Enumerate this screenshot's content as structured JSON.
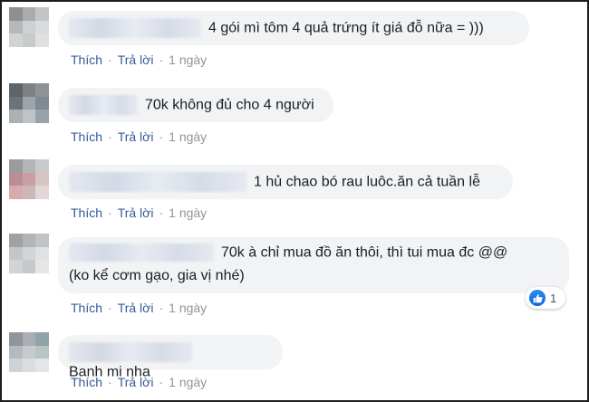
{
  "comments": [
    {
      "text": "4 gói mì tôm 4 quả trứng ít giá đỗ nữa = )))",
      "actions": {
        "like": "Thích",
        "reply": "Trả lời",
        "time": "1 ngày"
      }
    },
    {
      "text": "70k không đủ cho 4 người",
      "actions": {
        "like": "Thích",
        "reply": "Trả lời",
        "time": "1 ngày"
      }
    },
    {
      "text": "1 hủ chao bó rau luôc.ăn cả tuần lễ",
      "actions": {
        "like": "Thích",
        "reply": "Trả lời",
        "time": "1 ngày"
      }
    },
    {
      "text_line1": "70k à chỉ mua đồ ăn thôi, thì tui mua đc @@",
      "text_line2": "(ko kể cơm gạo, gia vị nhé)",
      "actions": {
        "like": "Thích",
        "reply": "Trả lời",
        "time": "1 ngày"
      },
      "reaction_count": "1"
    },
    {
      "text": "Banh mi nha",
      "actions": {
        "like": "Thích",
        "reply": "Trả lời",
        "time": "1 ngày"
      }
    }
  ],
  "separator": "·",
  "colors": {
    "like_blue": "#1877f2",
    "link": "#385898",
    "bubble": "#f2f3f5"
  },
  "icons": {
    "reaction": "thumbs-up-icon"
  }
}
